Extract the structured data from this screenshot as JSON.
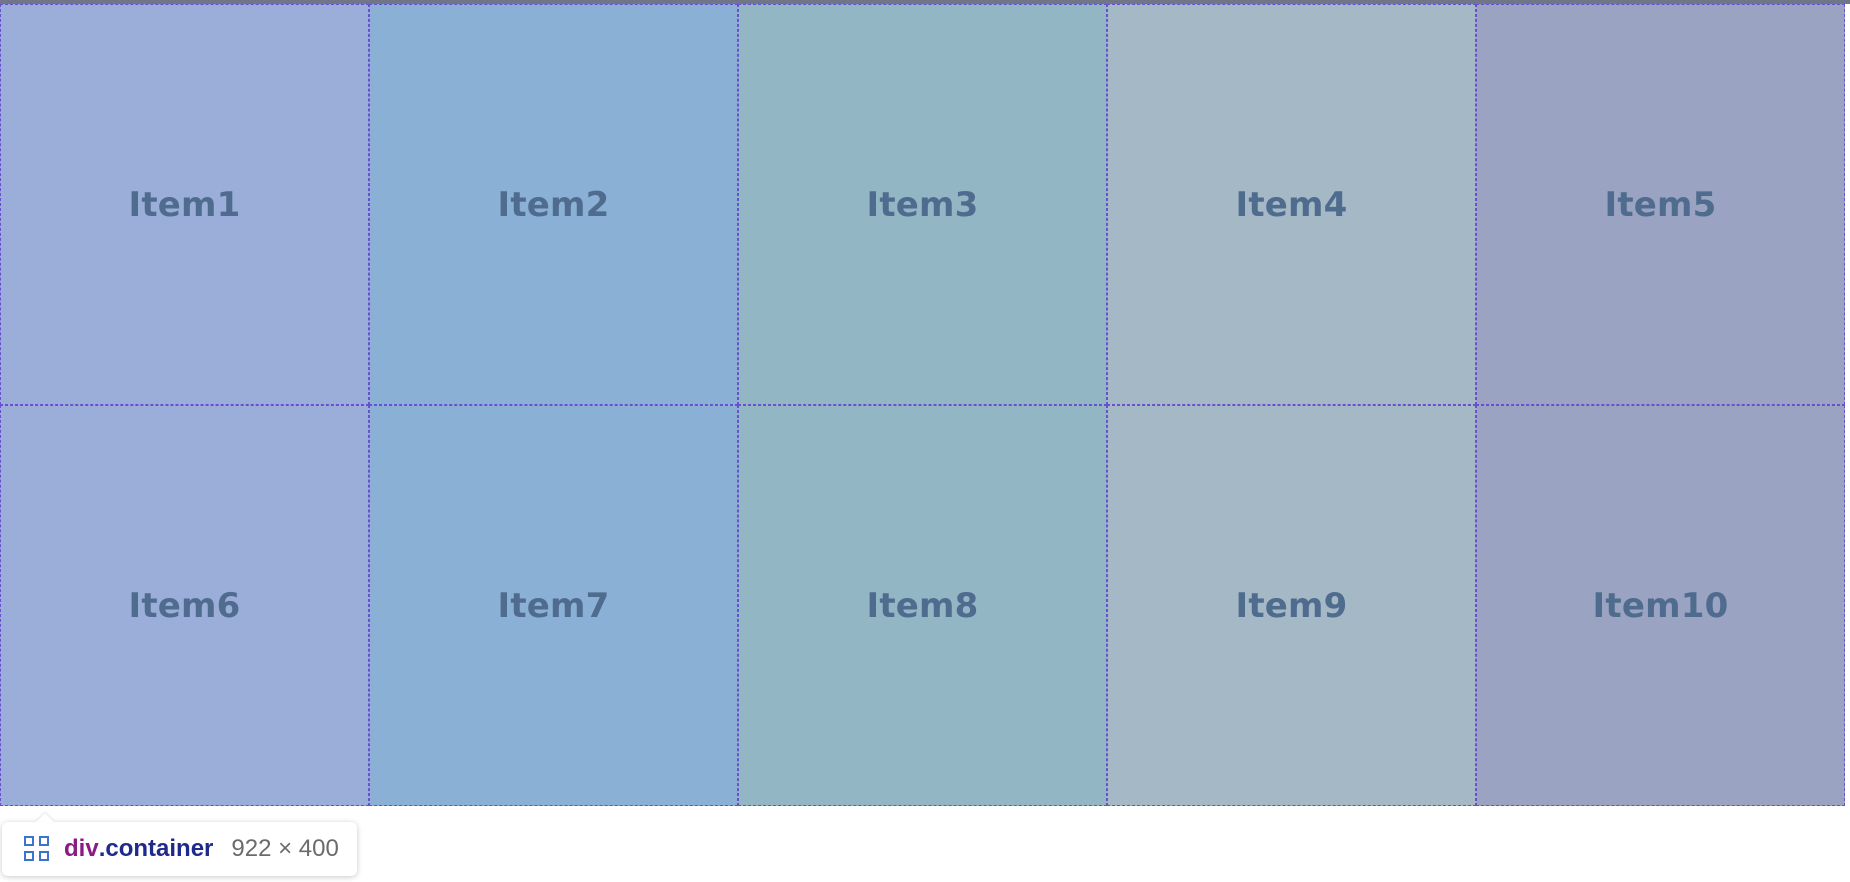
{
  "items": [
    {
      "label": "Item1",
      "color": "#9aaed9"
    },
    {
      "label": "Item2",
      "color": "#8bb0d6"
    },
    {
      "label": "Item3",
      "color": "#93b6c5"
    },
    {
      "label": "Item4",
      "color": "#a4b9c5"
    },
    {
      "label": "Item5",
      "color": "#9aa4c2"
    },
    {
      "label": "Item6",
      "color": "#9aaed9"
    },
    {
      "label": "Item7",
      "color": "#8bb0d6"
    },
    {
      "label": "Item8",
      "color": "#93b6c5"
    },
    {
      "label": "Item9",
      "color": "#a4b9c5"
    },
    {
      "label": "Item10",
      "color": "#9aa4c2"
    }
  ],
  "tooltip": {
    "icon": "grid-layout-icon",
    "tag": "div",
    "class_name": ".container",
    "dimensions": "922 × 400"
  },
  "colors": {
    "text": "#4f6c8f",
    "outline": "#6a4fd2",
    "tag": "#8a1b86",
    "class": "#1e2a8c"
  }
}
